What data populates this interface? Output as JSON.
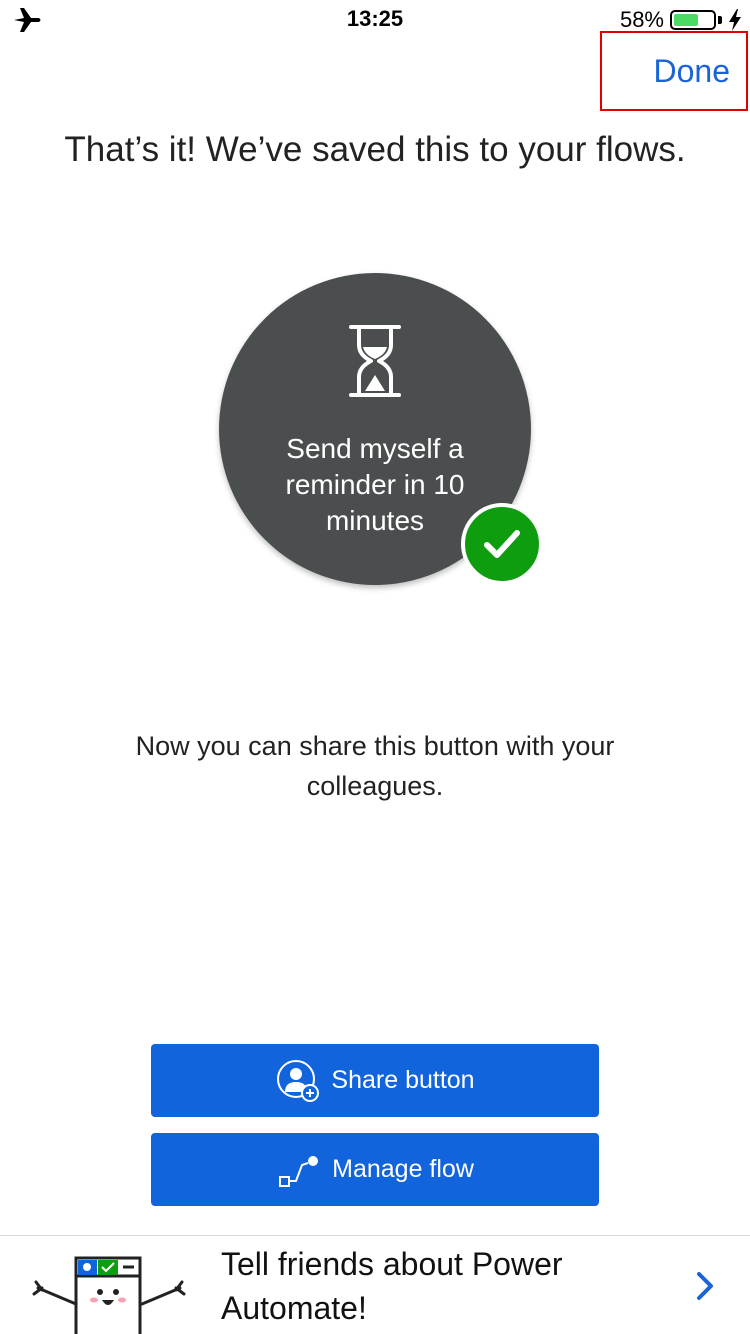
{
  "status_bar": {
    "time": "13:25",
    "battery_percent": "58%",
    "battery_level": 0.58,
    "icons": [
      "airplane-icon",
      "battery-icon",
      "charging-bolt-icon"
    ]
  },
  "header": {
    "done_label": "Done"
  },
  "headline": "That’s it! We’ve saved this to your flows.",
  "flow": {
    "name": "Send myself a reminder in 10 minutes",
    "icon": "hourglass-icon",
    "status_icon": "checkmark-icon"
  },
  "share_info": "Now you can share this button with your colleagues.",
  "actions": {
    "share_label": "Share button",
    "share_icon": "share-user-icon",
    "manage_label": "Manage flow",
    "manage_icon": "flow-icon"
  },
  "promo": {
    "text": "Tell friends about Power Automate!",
    "icon": "chevron-right-icon"
  },
  "colors": {
    "accent": "#1264dc",
    "link": "#1a64d8",
    "circle": "#4b4e4f",
    "success": "#0f9d10",
    "highlight_border": "#e00000"
  }
}
